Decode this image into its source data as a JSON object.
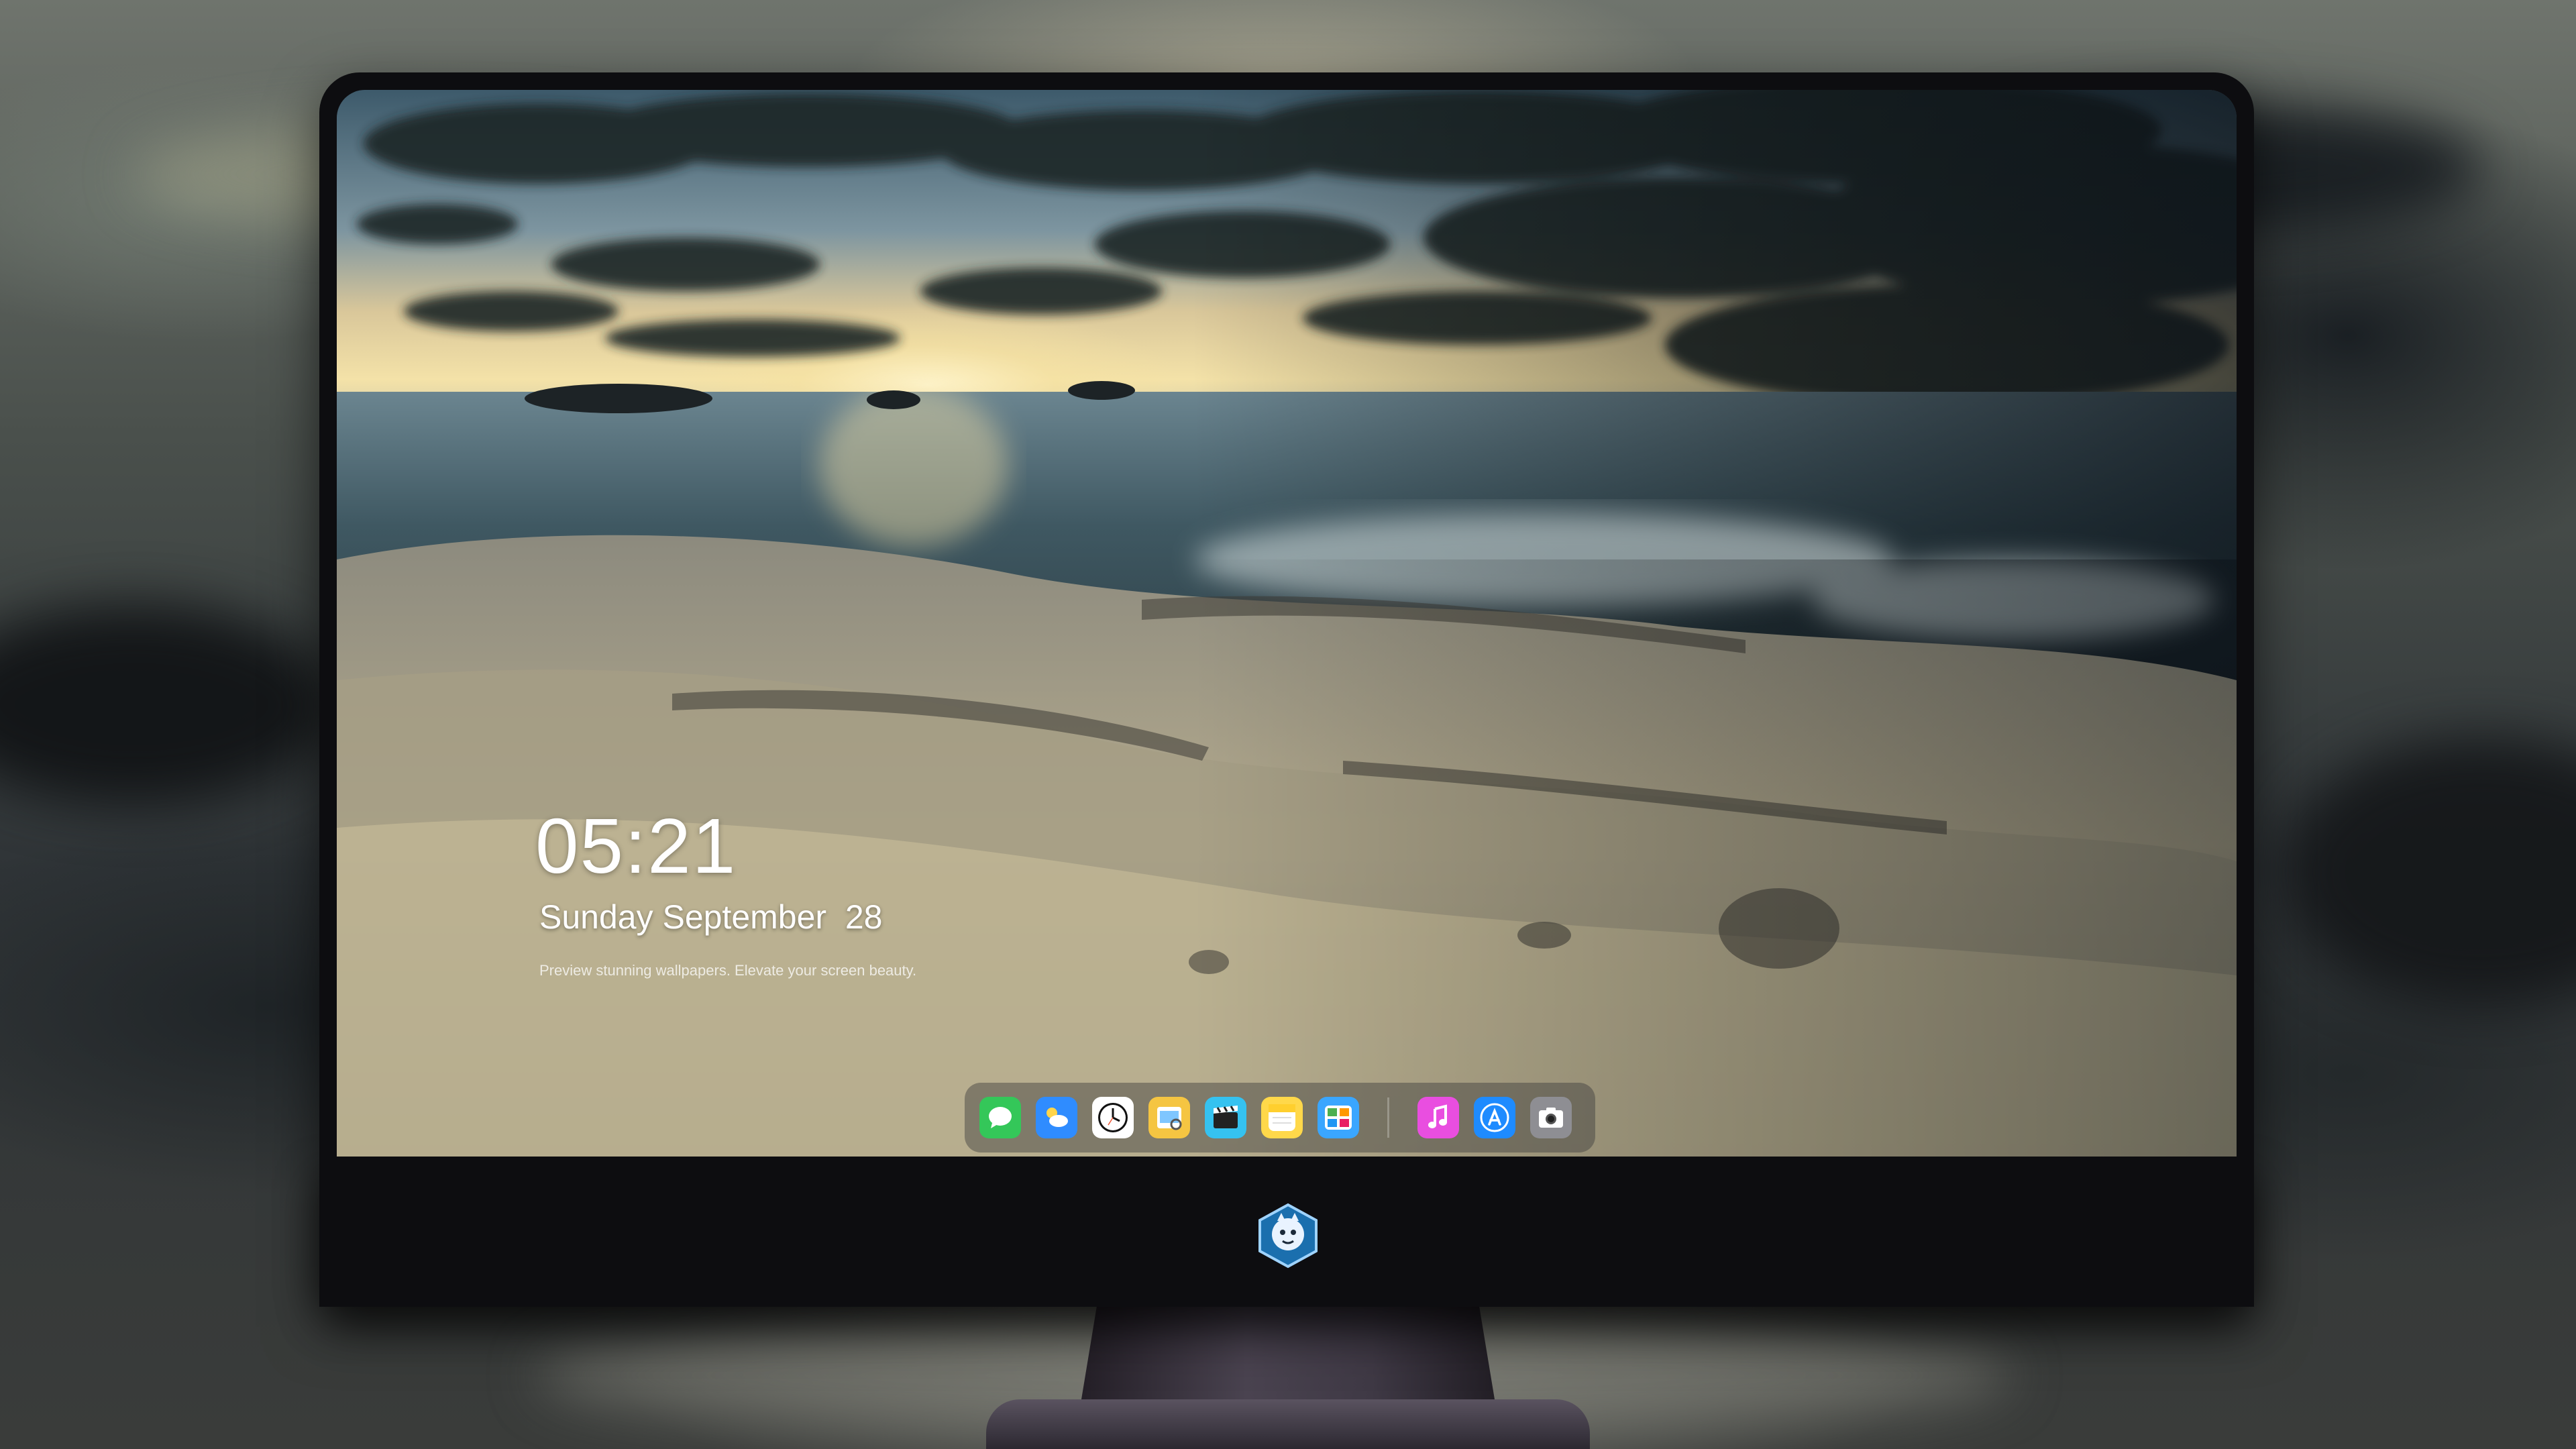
{
  "lockscreen": {
    "time": "05:21",
    "date": "Sunday September  28",
    "tagline": "Preview stunning wallpapers. Elevate your screen beauty."
  },
  "dock": {
    "left_apps": [
      {
        "name": "messages-icon",
        "color": "#34c759"
      },
      {
        "name": "weather-icon",
        "color": "#2f8cff"
      },
      {
        "name": "clock-icon",
        "color": "#ffffff"
      },
      {
        "name": "preview-icon",
        "color": "#f5c542"
      },
      {
        "name": "clips-icon",
        "color": "#35c2f0"
      },
      {
        "name": "notes-icon",
        "color": "#ffd84a"
      },
      {
        "name": "photos-gallery-icon",
        "color": "#3aa6ff"
      }
    ],
    "right_apps": [
      {
        "name": "music-icon",
        "color": "#e94ee0"
      },
      {
        "name": "app-store-icon",
        "color": "#1e8bff"
      },
      {
        "name": "camera-icon",
        "color": "#8e8e93"
      }
    ]
  },
  "colors": {
    "monitor_bezel": "#0d0d10",
    "monitor_chin": "#3b3540"
  }
}
